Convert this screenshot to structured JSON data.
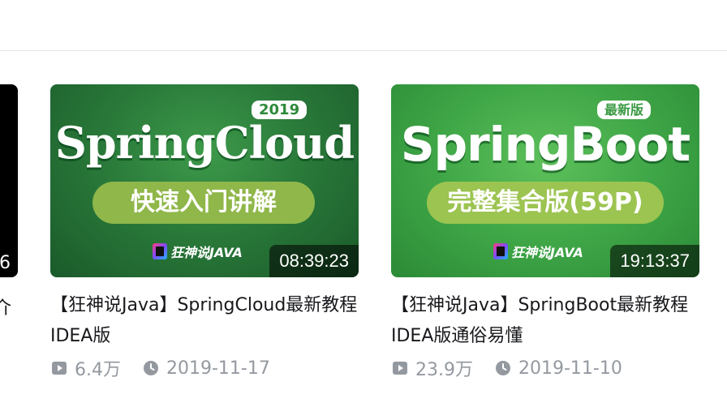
{
  "partial_card": {
    "duration_tail": "6",
    "title_tail": "介"
  },
  "cards": [
    {
      "thumbnail": {
        "badge": "2019",
        "title": "SpringCloud",
        "subtitle": "快速入门讲解",
        "brand": "狂神说JAVA",
        "duration": "08:39:23"
      },
      "title": "【狂神说Java】SpringCloud最新教程IDEA版",
      "views": "6.4万",
      "date": "2019-11-17"
    },
    {
      "thumbnail": {
        "badge": "最新版",
        "title": "SpringBoot",
        "subtitle": "完整集合版(59P)",
        "brand": "狂神说JAVA",
        "duration": "19:13:37"
      },
      "title": "【狂神说Java】SpringBoot最新教程IDEA版通俗易懂",
      "views": "23.9万",
      "date": "2019-11-10"
    }
  ],
  "icons": {
    "views": "play-icon",
    "date": "clock-icon"
  },
  "colors": {
    "meta_text": "#9499a0",
    "title_text": "#18191c",
    "divider": "#e3e5e7"
  }
}
